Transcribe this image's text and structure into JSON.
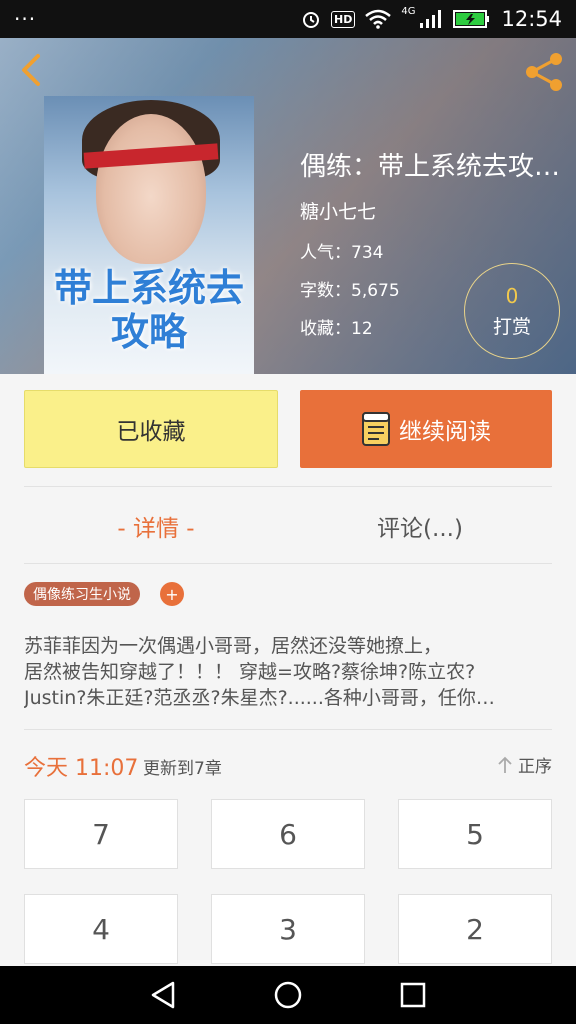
{
  "status_bar": {
    "left": "···",
    "time": "12:54",
    "hd": "HD",
    "net": "4G"
  },
  "header": {
    "cover_title": "带上系统去攻略",
    "title": "偶练：带上系统去攻…",
    "author": "糖小七七",
    "popularity": "人气：734",
    "word_count": "字数：5,675",
    "favorites": "收藏：12",
    "reward_count": "0",
    "reward_label": "打赏"
  },
  "actions": {
    "favorited_label": "已收藏",
    "continue_label": "继续阅读"
  },
  "tabs": {
    "detail": "- 详情 -",
    "comments": "评论(...)"
  },
  "tag": {
    "label": "偶像练习生小说",
    "add": "+"
  },
  "summary": {
    "line1": "苏菲菲因为一次偶遇小哥哥，居然还没等她撩上，",
    "line2": "居然被告知穿越了！！！ 穿越=攻略?蔡徐坤?陈立农?",
    "line3": "Justin?朱正廷?范丞丞?朱星杰?......各种小哥哥，任你…"
  },
  "updates": {
    "time": "今天 11:07",
    "text": "更新到7章",
    "sort_label": "正序"
  },
  "chapters": [
    "7",
    "6",
    "5",
    "4",
    "3",
    "2"
  ],
  "colors": {
    "accent": "#e8703a",
    "favorited_bg": "#faf08a",
    "tag_bg": "#c0654a"
  }
}
